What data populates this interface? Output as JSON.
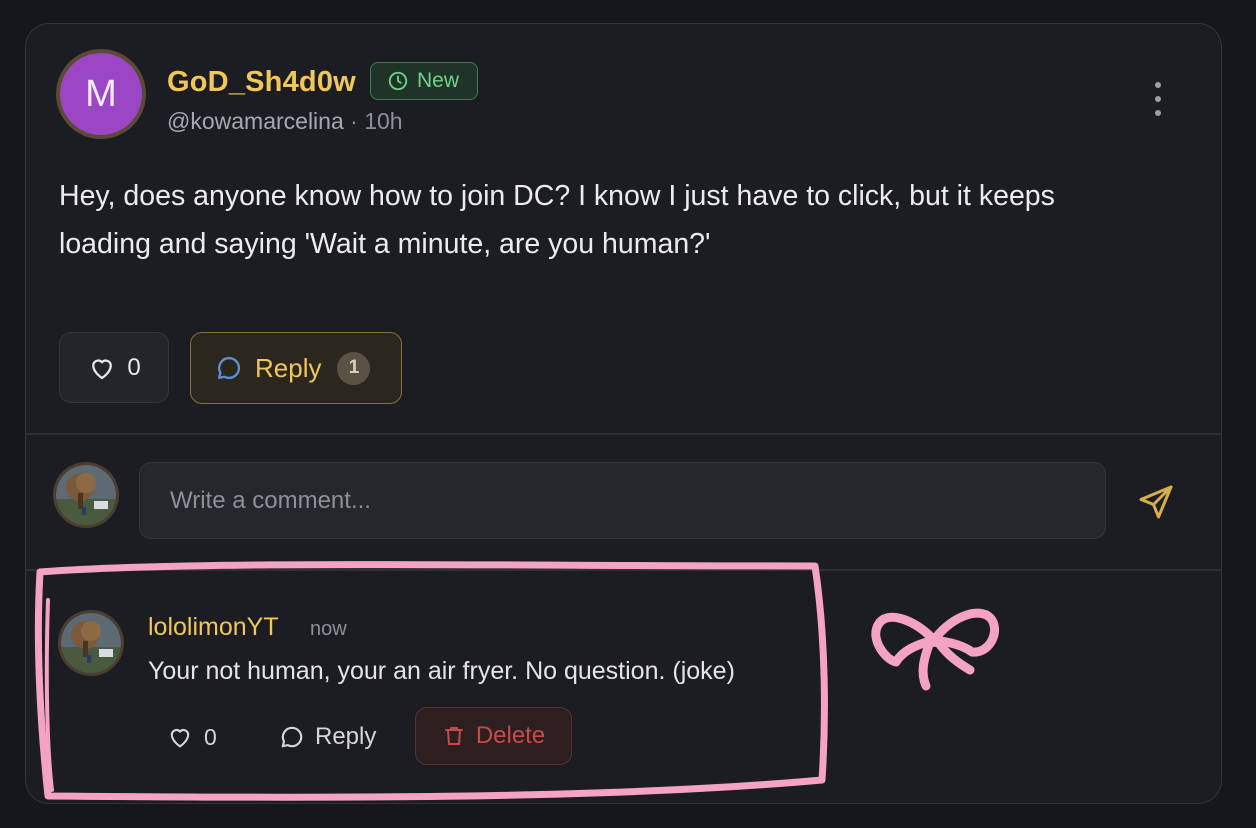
{
  "post": {
    "avatar_letter": "M",
    "author_name": "GoD_Sh4d0w",
    "badge": "New",
    "handle": "@kowamarcelina",
    "separator": " · ",
    "time": "10h",
    "text_line1": "Hey, does anyone know how to join DC? I know I just have to click, but it keeps",
    "text_line2": "loading and saying 'Wait a minute, are you human?'",
    "like_count": "0",
    "reply_label": "Reply",
    "reply_count": "1"
  },
  "comment_box": {
    "placeholder": "Write a comment..."
  },
  "comment": {
    "author": "lololimonYT",
    "time": "now",
    "text": "Your not human, your an air fryer. No question. (joke)",
    "like_count": "0",
    "reply_label": "Reply",
    "delete_label": "Delete"
  },
  "colors": {
    "accent_gold": "#f1c75a",
    "badge_green": "#6fd28a",
    "delete_red": "#c84a48",
    "highlight_pink": "#f4a3c3",
    "avatar_purple": "#9b46c4"
  },
  "icons": [
    "clock-icon",
    "more-vertical-icon",
    "heart-icon",
    "chat-bubble-icon",
    "send-icon",
    "trash-icon",
    "bow-doodle"
  ]
}
